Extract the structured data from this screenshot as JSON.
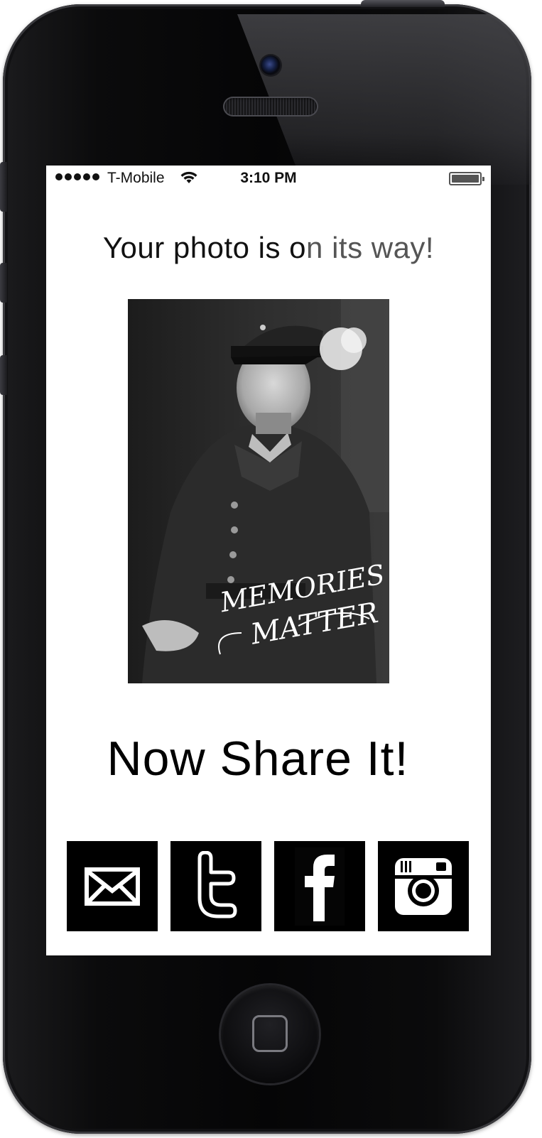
{
  "status_bar": {
    "signal_dots": 5,
    "carrier": "T-Mobile",
    "time": "3:10 PM",
    "battery_level": 1.0
  },
  "main": {
    "heading_dark": "Your photo is o",
    "heading_light": "n its way!",
    "photo_logo_line1": "MEMORIES",
    "photo_logo_line2": "MATTER",
    "share_title": "Now Share It!"
  },
  "share_buttons": [
    {
      "icon": "envelope-icon",
      "service": "email"
    },
    {
      "icon": "twitter-icon",
      "service": "twitter"
    },
    {
      "icon": "facebook-icon",
      "service": "facebook"
    },
    {
      "icon": "instagram-icon",
      "service": "instagram"
    }
  ],
  "colors": {
    "screen_background": "#ffffff",
    "text": "#111111",
    "share_button_background": "#000000",
    "share_icon": "#ffffff"
  }
}
